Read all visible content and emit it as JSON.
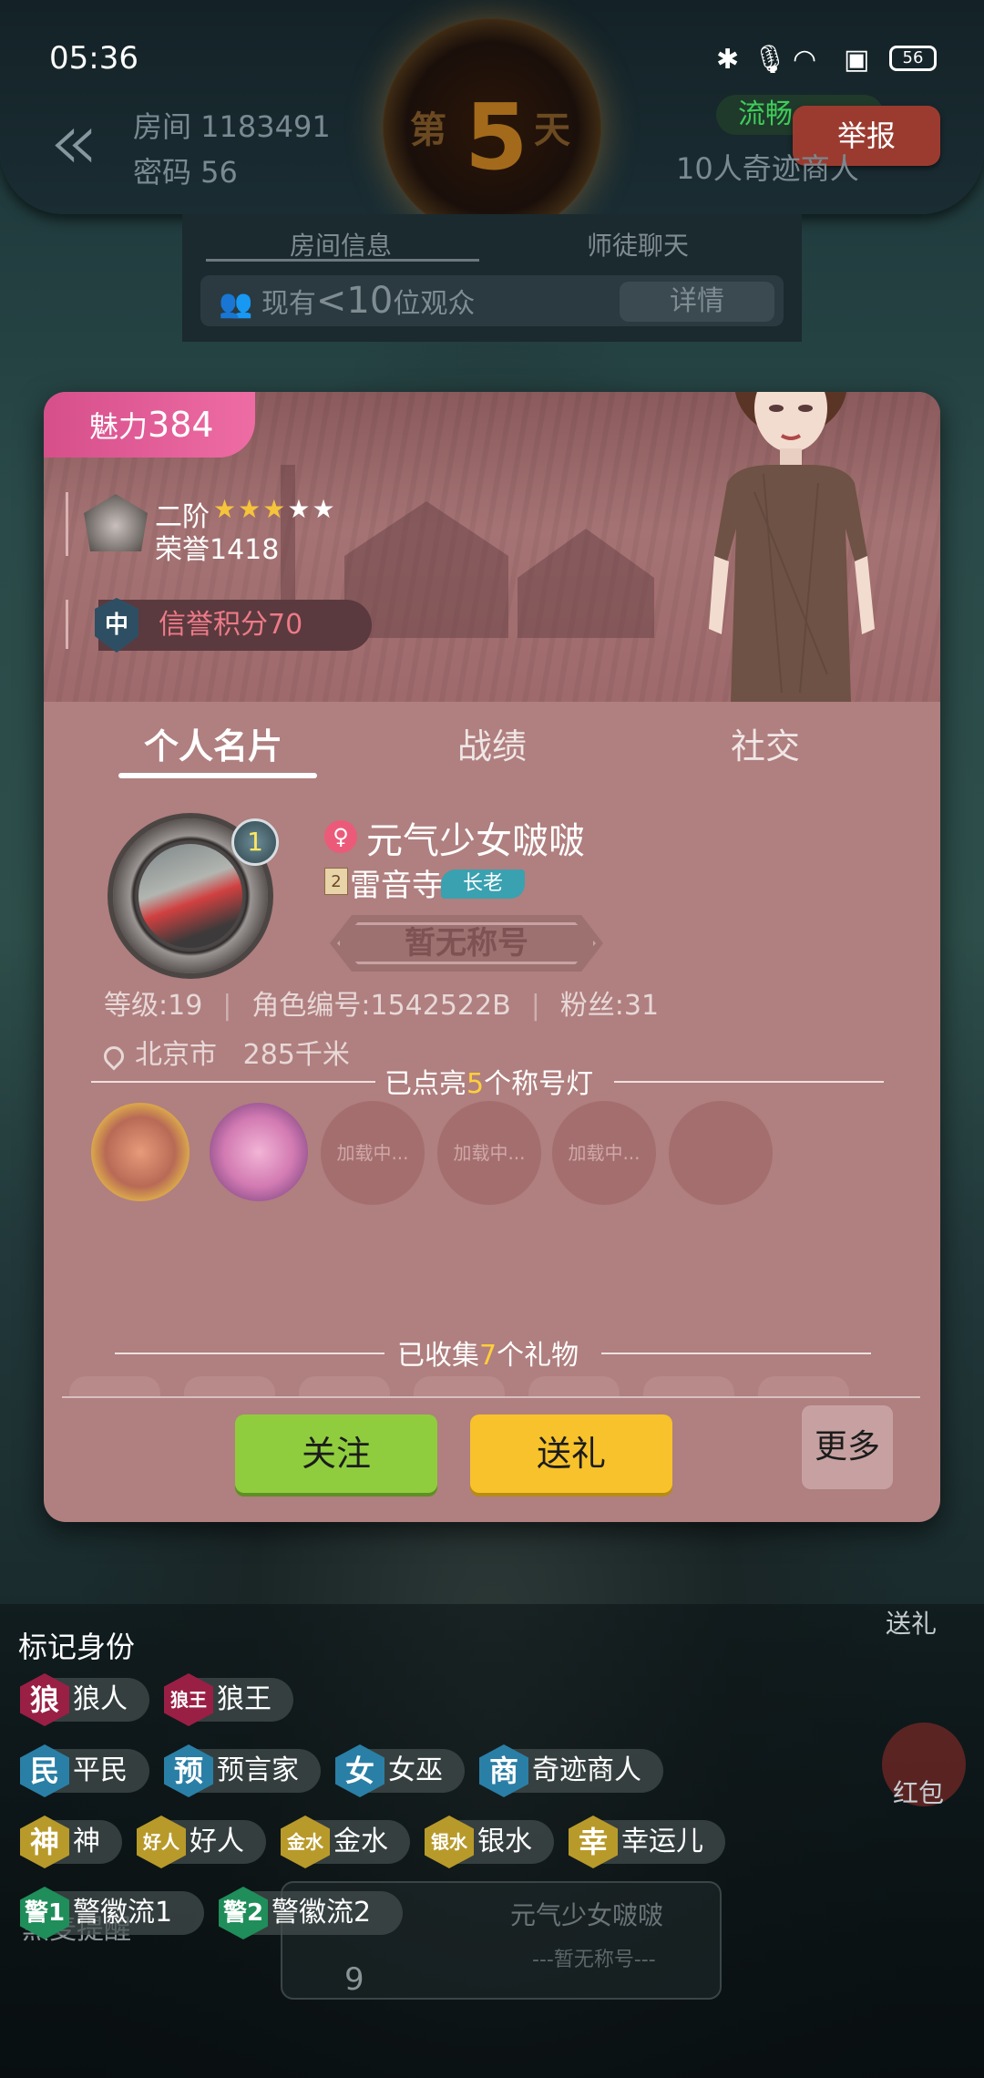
{
  "status_bar": {
    "time": "05:36",
    "battery": "56"
  },
  "room": {
    "room_label": "房间 1183491",
    "password_label": "密码 56",
    "day_prefix": "第",
    "day_number": "5",
    "day_suffix": "天",
    "network_status": "流畅",
    "report_label": "举报",
    "mode": "10人奇迹商人",
    "tabs": [
      "房间信息",
      "师徒聊天"
    ],
    "viewers_prefix": "现有",
    "viewers_count": "<10",
    "viewers_suffix": "位观众",
    "details_label": "详情"
  },
  "profile": {
    "charm_label": "魅力",
    "charm_value": "384",
    "rank_label": "二阶",
    "rank_stars_filled": 3,
    "rank_stars_total": 5,
    "honor_label": "荣誉1418",
    "credit_badge": "中",
    "credit_label": "信誉积分70",
    "tabs": [
      "个人名片",
      "战绩",
      "社交"
    ],
    "avatar_level": "1",
    "nickname": "元气少女啵啵",
    "guild_rank": "2",
    "guild_name": "雷音寺",
    "guild_role": "长老",
    "title_plate": "暂无称号",
    "level": "等级:19",
    "role_id": "角色编号:1542522B",
    "fans": "粉丝:31",
    "city": "北京市",
    "distance": "285千米",
    "lights_prefix": "已点亮",
    "lights_count": "5",
    "lights_suffix": "个称号灯",
    "loading_label": "加载中...",
    "gifts_prefix": "已收集",
    "gifts_count": "7",
    "gifts_suffix": "个礼物",
    "follow_label": "关注",
    "gift_label": "送礼",
    "more_label": "更多"
  },
  "marker_panel": {
    "title": "标记身份",
    "rows": [
      [
        {
          "badge": "狼",
          "label": "狼人",
          "kind": "wolf"
        },
        {
          "badge": "狼王",
          "label": "狼王",
          "kind": "wolf"
        }
      ],
      [
        {
          "badge": "民",
          "label": "平民",
          "kind": "good"
        },
        {
          "badge": "预",
          "label": "预言家",
          "kind": "good"
        },
        {
          "badge": "女",
          "label": "女巫",
          "kind": "good"
        },
        {
          "badge": "商",
          "label": "奇迹商人",
          "kind": "good"
        }
      ],
      [
        {
          "badge": "神",
          "label": "神",
          "kind": "god"
        },
        {
          "badge": "好人",
          "label": "好人",
          "kind": "god"
        },
        {
          "badge": "金水",
          "label": "金水",
          "kind": "god"
        },
        {
          "badge": "银水",
          "label": "银水",
          "kind": "god"
        },
        {
          "badge": "幸",
          "label": "幸运儿",
          "kind": "god"
        }
      ],
      [
        {
          "badge": "警1",
          "label": "警徽流1",
          "kind": "police"
        },
        {
          "badge": "警2",
          "label": "警徽流2",
          "kind": "police"
        }
      ]
    ]
  },
  "side": {
    "gift_label": "送礼",
    "redpack_label": "红包",
    "mic_reminder": "黑麦提醒",
    "seat_number": "9",
    "seat_name": "元气少女啵啵",
    "seat_title": "---暂无称号---"
  }
}
